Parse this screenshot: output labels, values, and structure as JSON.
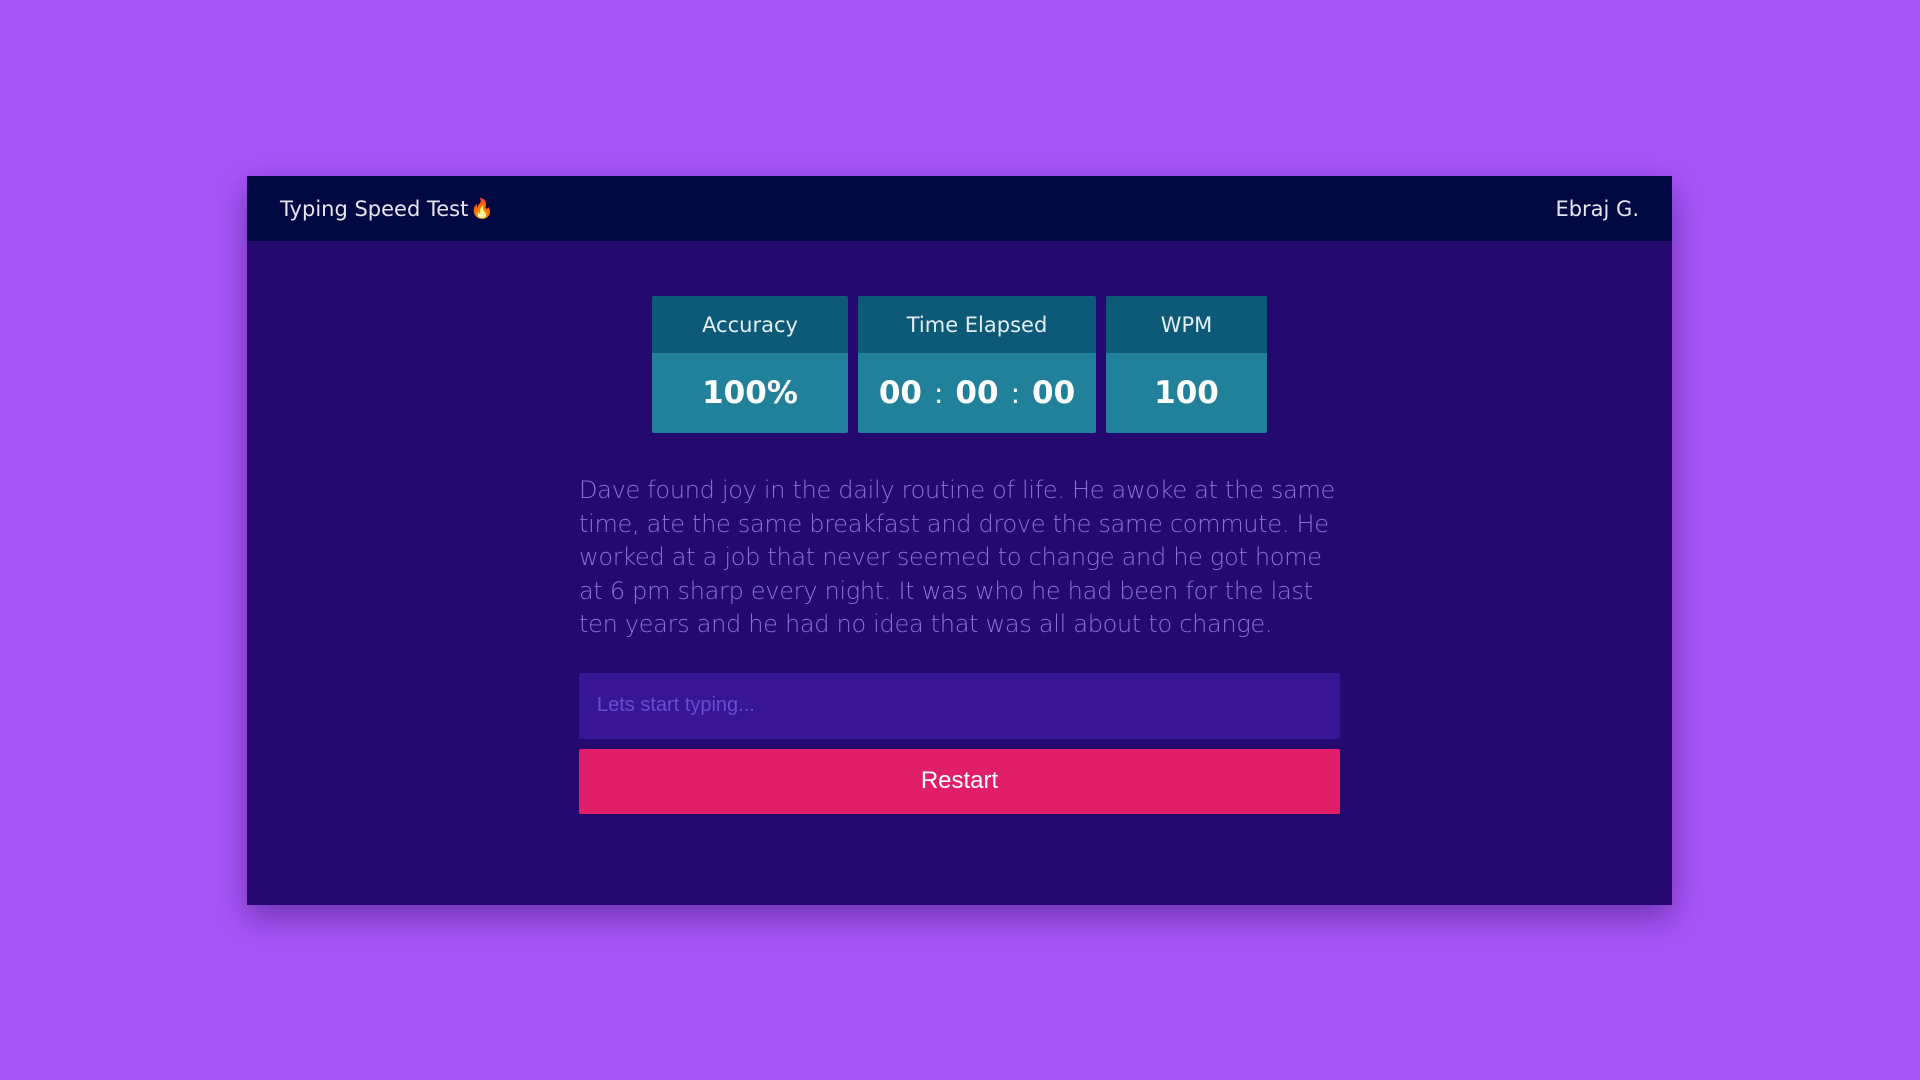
{
  "header": {
    "title": "Typing Speed Test",
    "flame_icon": "🔥",
    "user_name": "Ebraj G."
  },
  "stats": {
    "accuracy": {
      "label": "Accuracy",
      "value": "100%"
    },
    "time_elapsed": {
      "label": "Time Elapsed",
      "hours": "00",
      "minutes": "00",
      "seconds": "00",
      "separator": ":"
    },
    "wpm": {
      "label": "WPM",
      "value": "100"
    }
  },
  "passage": {
    "text": "Dave found joy in the daily routine of life. He awoke at the same time, ate the same breakfast and drove the same commute. He worked at a job that never seemed to change and he got home at 6 pm sharp every night. It was who he had been for the last ten years and he had no idea that was all about to change."
  },
  "input": {
    "placeholder": "Lets start typing...",
    "value": ""
  },
  "restart": {
    "label": "Restart"
  },
  "colors": {
    "page_background": "#a855f7",
    "window_background": "#250870",
    "navbar_background": "#010842",
    "stat_header": "#0c5a77",
    "stat_value": "#21819a",
    "passage_text": "#8d6ee0",
    "input_background": "#371594",
    "restart_button": "#e01f68"
  }
}
